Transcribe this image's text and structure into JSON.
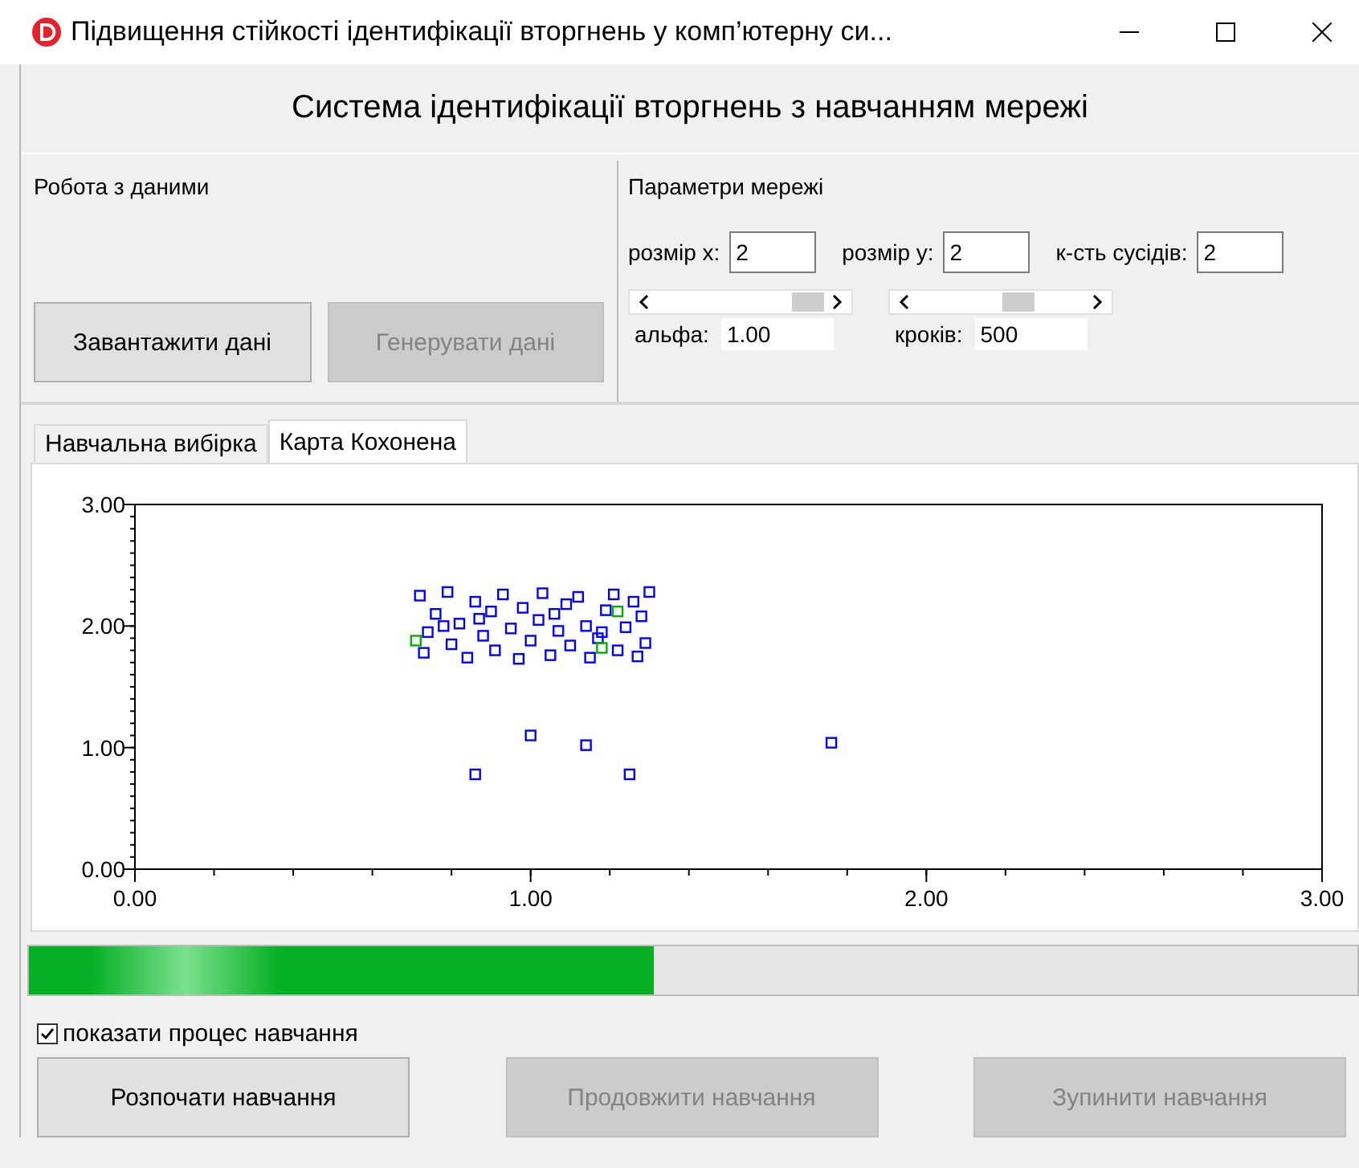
{
  "window": {
    "title": "Підвищення стійкості ідентифікації вторгнень у комп’ютерну си..."
  },
  "header": {
    "title": "Система ідентифікації вторгнень з навчанням мережі"
  },
  "data_panel": {
    "title": "Робота з даними",
    "buttons": [
      {
        "label": "Завантажити дані",
        "disabled": false
      },
      {
        "label": "Генерувати дані",
        "disabled": true
      }
    ]
  },
  "network_panel": {
    "title": "Параметри мережі",
    "fields": [
      {
        "label": "розмір х:",
        "value": "2"
      },
      {
        "label": "розмір у:",
        "value": "2"
      },
      {
        "label": "к-сть сусідів:",
        "value": "2"
      }
    ],
    "sliders": [
      {
        "label": "альфа:",
        "value": "1.00",
        "level": 0.9
      },
      {
        "label": "кроків:",
        "value": "500",
        "level": 0.6
      }
    ]
  },
  "tabs": [
    {
      "label": "Навчальна вибірка",
      "selected": false
    },
    {
      "label": "Карта Кохонена",
      "selected": true
    }
  ],
  "chart_data": {
    "type": "scatter",
    "xlim": [
      0,
      3
    ],
    "ylim": [
      0,
      3
    ],
    "xticks": [
      {
        "value": 0,
        "label": "0.00"
      },
      {
        "value": 1,
        "label": "1.00"
      },
      {
        "value": 2,
        "label": "2.00"
      },
      {
        "value": 3,
        "label": "3.00"
      }
    ],
    "yticks": [
      {
        "value": 0,
        "label": "0.00"
      },
      {
        "value": 1,
        "label": "1.00"
      },
      {
        "value": 2,
        "label": "2.00"
      },
      {
        "value": 3,
        "label": "3.00"
      }
    ],
    "x": [
      0.72,
      0.74,
      0.73,
      0.76,
      0.79,
      0.8,
      0.82,
      0.84,
      0.86,
      0.88,
      0.9,
      0.91,
      0.93,
      0.95,
      0.97,
      0.98,
      1.0,
      1.02,
      1.03,
      1.05,
      1.07,
      1.09,
      1.1,
      1.12,
      1.14,
      1.15,
      1.17,
      1.19,
      1.21,
      1.22,
      1.24,
      1.26,
      1.27,
      1.28,
      1.29,
      1.3,
      0.78,
      0.87,
      1.06,
      1.18,
      0.86,
      1.0,
      1.14,
      1.25,
      1.76,
      0.71,
      1.18,
      1.22
    ],
    "series": [
      {
        "color": "#0000ff",
        "values": [
          2.25,
          1.95,
          1.78,
          2.1,
          2.28,
          1.85,
          2.02,
          1.74,
          2.2,
          1.92,
          2.12,
          1.8,
          2.26,
          1.98,
          1.73,
          2.15,
          1.88,
          2.05,
          2.27,
          1.76,
          1.96,
          2.18,
          1.84,
          2.24,
          2.0,
          1.74,
          1.9,
          2.13,
          2.26,
          1.8,
          1.99,
          2.2,
          1.75,
          2.08,
          1.86,
          2.28,
          2.0,
          2.06,
          2.1,
          1.95,
          0.78,
          1.1,
          1.02,
          0.78,
          1.04,
          null,
          null,
          null
        ]
      },
      {
        "color": "#00b000",
        "values": [
          null,
          null,
          null,
          null,
          null,
          null,
          null,
          null,
          null,
          null,
          null,
          null,
          null,
          null,
          null,
          null,
          null,
          null,
          null,
          null,
          null,
          null,
          null,
          null,
          null,
          null,
          null,
          null,
          null,
          null,
          null,
          null,
          null,
          null,
          null,
          null,
          null,
          null,
          null,
          null,
          null,
          null,
          null,
          null,
          null,
          1.88,
          1.82,
          2.12
        ]
      }
    ]
  },
  "progress": {
    "level": 0.47
  },
  "show_process": {
    "label": "показати процес навчання",
    "checked": true
  },
  "buttons": [
    {
      "label": "Розпочати навчання",
      "disabled": false
    },
    {
      "label": "Продовжити навчання",
      "disabled": true
    },
    {
      "label": "Зупинити навчання",
      "disabled": true
    }
  ]
}
